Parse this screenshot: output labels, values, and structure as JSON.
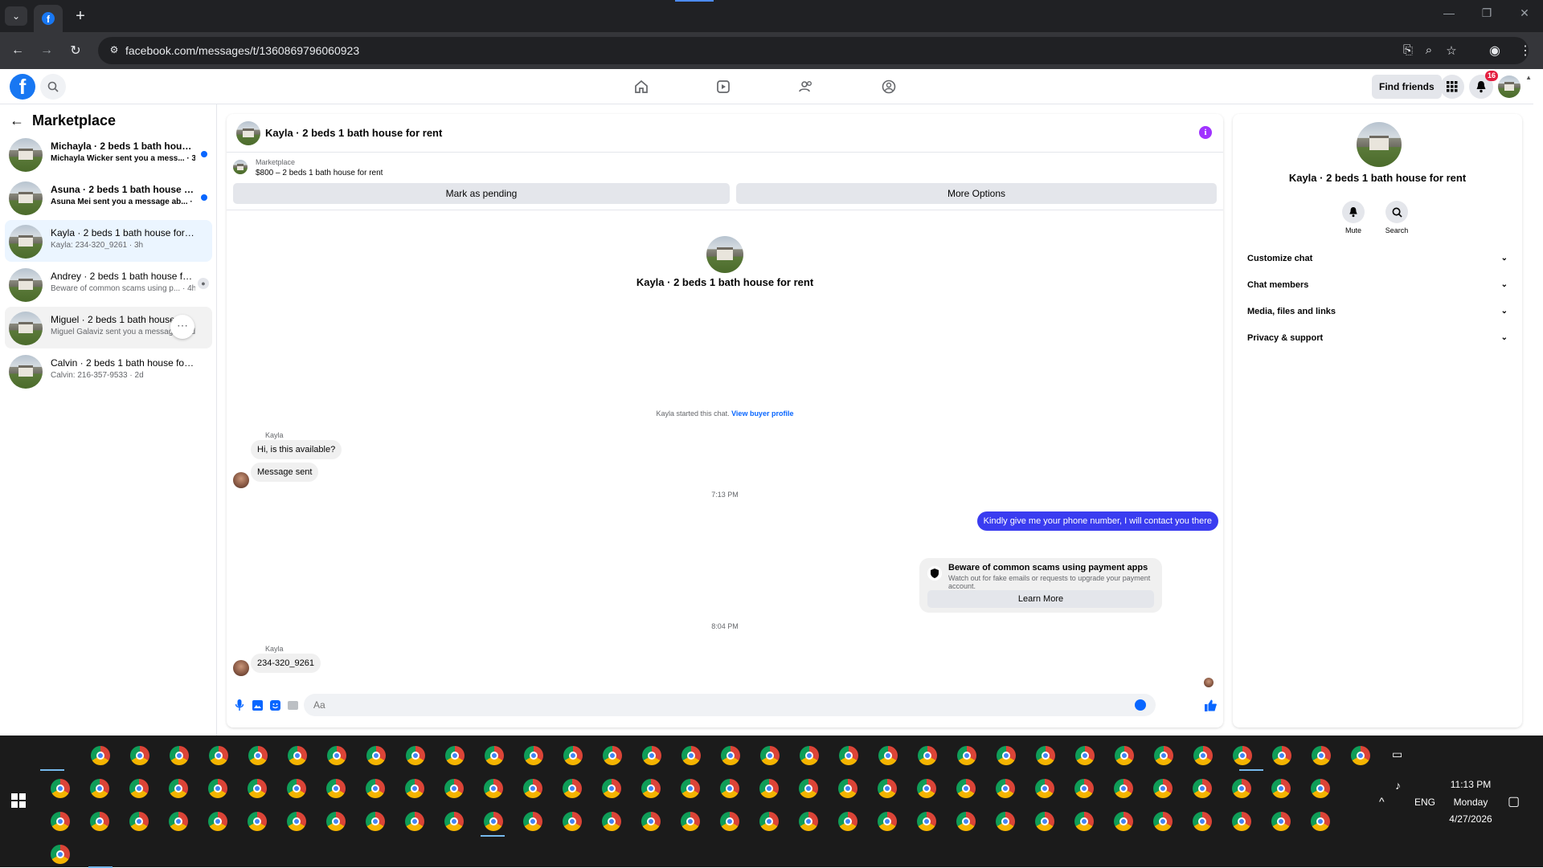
{
  "browser": {
    "url": "facebook.com/messages/t/1360869796060923",
    "window_controls": [
      "—",
      "❐",
      "✕"
    ]
  },
  "header": {
    "find_friends": "Find friends",
    "notification_count": "16"
  },
  "sidebar": {
    "title": "Marketplace",
    "conversations": [
      {
        "name": "Michayla · 2 beds 1 bath house f...",
        "sub": "Michayla Wicker sent you a mess... · 31m",
        "unread": true
      },
      {
        "name": "Asuna · 2 beds 1 bath house for r...",
        "sub": "Asuna Mei sent you a message ab... · 1h",
        "unread": true
      },
      {
        "name": "Kayla · 2 beds 1 bath house for rent",
        "sub": "Kayla: 234-320_9261 · 3h",
        "unread": false
      },
      {
        "name": "Andrey · 2 beds 1 bath house for...",
        "sub": "Beware of common scams using p... · 4h",
        "unread": false
      },
      {
        "name": "Miguel · 2 beds 1 bath house fo...",
        "sub": "Miguel Galaviz sent you a message a...d",
        "unread": false
      },
      {
        "name": "Calvin · 2 beds 1 bath house for rent",
        "sub": "Calvin: 216-357-9533 · 2d",
        "unread": false
      }
    ]
  },
  "chat": {
    "title": "Kayla · 2 beds 1 bath house for rent",
    "listing_source": "Marketplace",
    "listing_price": "$800 – 2 beds 1 bath house for rent",
    "mark_pending": "Mark as pending",
    "more_options": "More Options",
    "intro_title": "Kayla · 2 beds 1 bath house for rent",
    "started_text": "Kayla started this chat.",
    "view_profile": "View buyer profile",
    "sender_name_1": "Kayla",
    "msg_1": "Hi, is this available?",
    "msg_2": "Message sent",
    "time_1": "7:13 PM",
    "msg_out": "Kindly give me your phone number, I will contact you there",
    "scam_title": "Beware of common scams using payment apps",
    "scam_desc": "Watch out for fake emails or requests to upgrade your payment account.",
    "learn_more": "Learn More",
    "time_2": "8:04 PM",
    "sender_name_2": "Kayla",
    "msg_3": "234-320_9261",
    "composer_placeholder": "Aa"
  },
  "info_panel": {
    "title": "Kayla · 2 beds 1 bath house for rent",
    "mute": "Mute",
    "search": "Search",
    "sections": [
      "Customize chat",
      "Chat members",
      "Media, files and links",
      "Privacy & support"
    ]
  },
  "taskbar": {
    "language": "ENG",
    "time": "11:13 PM",
    "day": "Monday",
    "date": "4/27/2026"
  },
  "colors": {
    "brand": "#1877f2",
    "outgoing_bubble": "#3a3cf0",
    "unread_dot": "#0866ff"
  }
}
